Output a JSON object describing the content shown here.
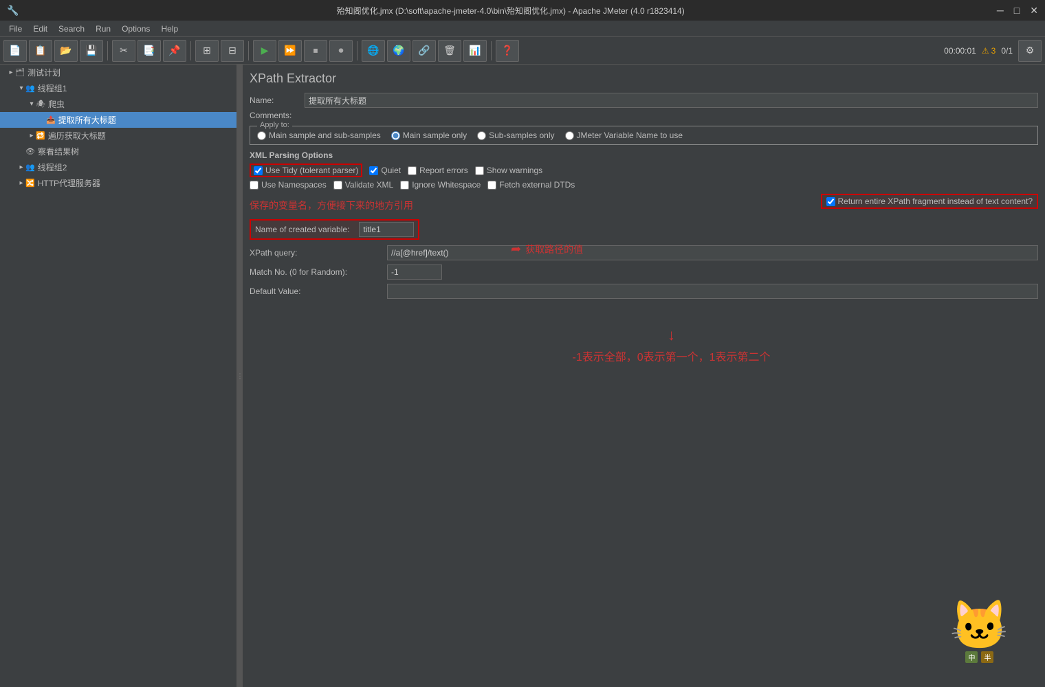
{
  "titlebar": {
    "title": "殆知阁优化.jmx (D:\\soft\\apache-jmeter-4.0\\bin\\殆知阁优化.jmx) - Apache JMeter (4.0 r1823414)",
    "minimize": "─",
    "maximize": "□",
    "close": "✕"
  },
  "menubar": {
    "items": [
      "File",
      "Edit",
      "Search",
      "Run",
      "Options",
      "Help"
    ]
  },
  "toolbar": {
    "time": "00:00:01",
    "warn_count": "3",
    "ratio": "0/1"
  },
  "tree": {
    "items": [
      {
        "label": "测试计划",
        "level": 1,
        "icon": "▸",
        "type": "plan"
      },
      {
        "label": "线程组1",
        "level": 2,
        "icon": "▾",
        "type": "thread"
      },
      {
        "label": "爬虫",
        "level": 3,
        "icon": "▾",
        "type": "sampler"
      },
      {
        "label": "提取所有大标题",
        "level": 4,
        "icon": "◆",
        "type": "extractor",
        "selected": true
      },
      {
        "label": "遍历获取大标题",
        "level": 3,
        "icon": "▸",
        "type": "controller"
      },
      {
        "label": "察看结果树",
        "level": 2,
        "icon": "◆",
        "type": "listener"
      },
      {
        "label": "线程组2",
        "level": 2,
        "icon": "▸",
        "type": "thread"
      },
      {
        "label": "HTTP代理服务器",
        "level": 2,
        "icon": "▸",
        "type": "proxy"
      }
    ]
  },
  "panel": {
    "title": "XPath Extractor",
    "name_label": "Name:",
    "name_value": "提取所有大标题",
    "comments_label": "Comments:",
    "apply_to": {
      "label": "Apply to:",
      "options": [
        {
          "id": "main_sub",
          "label": "Main sample and sub-samples",
          "checked": false
        },
        {
          "id": "main_only",
          "label": "Main sample only",
          "checked": true
        },
        {
          "id": "sub_only",
          "label": "Sub-samples only",
          "checked": false
        },
        {
          "id": "jmeter_var",
          "label": "JMeter Variable Name to use",
          "checked": false
        }
      ]
    },
    "xml_options": {
      "title": "XML Parsing Options",
      "row1": [
        {
          "label": "Use Tidy (tolerant parser)",
          "checked": true,
          "highlighted": true
        },
        {
          "label": "Quiet",
          "checked": true
        },
        {
          "label": "Report errors",
          "checked": false
        },
        {
          "label": "Show warnings",
          "checked": false
        }
      ],
      "row2": [
        {
          "label": "Use Namespaces",
          "checked": false
        },
        {
          "label": "Validate XML",
          "checked": false
        },
        {
          "label": "Ignore Whitespace",
          "checked": false
        },
        {
          "label": "Fetch external DTDs",
          "checked": false
        }
      ]
    },
    "return_fragment": {
      "label": "Return entire XPath fragment instead of text content?",
      "checked": true,
      "highlighted": true
    },
    "variable": {
      "label": "Name of created variable:",
      "value": "title1"
    },
    "xpath": {
      "label": "XPath query:",
      "value": "//a[@href]/text()"
    },
    "match_no": {
      "label": "Match No. (0 for Random):",
      "value": "-1"
    },
    "default_value": {
      "label": "Default Value:",
      "value": ""
    }
  },
  "annotations": {
    "variable_note": "保存的变量名，方便接下来的地方引用",
    "xpath_note": "获取路径的值",
    "match_note": "-1表示全部，0表示第一个，1表示第二个"
  }
}
